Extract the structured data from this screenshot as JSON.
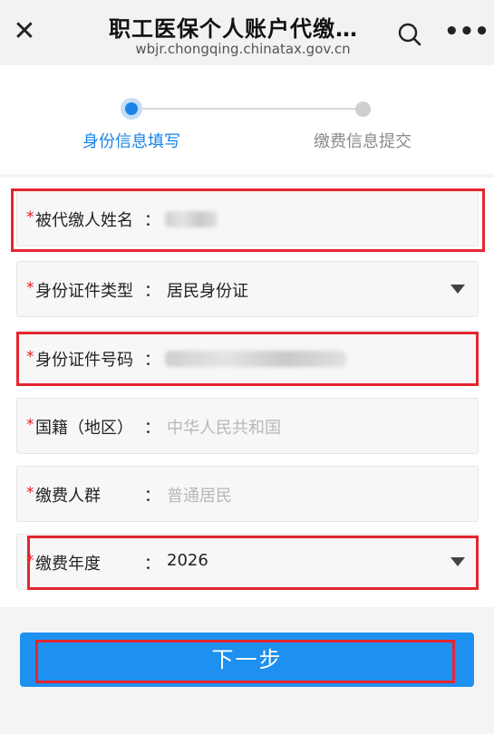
{
  "header": {
    "title": "职工医保个人账户代缴城…",
    "subtitle": "wbjr.chongqing.chinatax.gov.cn",
    "close_icon": "close-icon",
    "search_icon": "search-icon",
    "more_icon": "more-icon"
  },
  "steps": [
    {
      "label": "身份信息填写",
      "state": "active"
    },
    {
      "label": "缴费信息提交",
      "state": "inactive"
    }
  ],
  "colors": {
    "accent": "#1a84e8",
    "required": "#e02020",
    "highlight": "#e3262f"
  },
  "form": {
    "required_mark": "*",
    "colon": "：",
    "payee_name": {
      "label": "被代缴人姓名"
    },
    "id_type": {
      "label": "身份证件类型",
      "value": "居民身份证"
    },
    "id_number": {
      "label": "身份证件号码"
    },
    "nationality": {
      "label": "国籍（地区）",
      "placeholder": "中华人民共和国"
    },
    "payer_group": {
      "label": "缴费人群",
      "placeholder": "普通居民"
    },
    "pay_year": {
      "label": "缴费年度",
      "value": "2026"
    }
  },
  "next_button": {
    "label": "下一步"
  }
}
